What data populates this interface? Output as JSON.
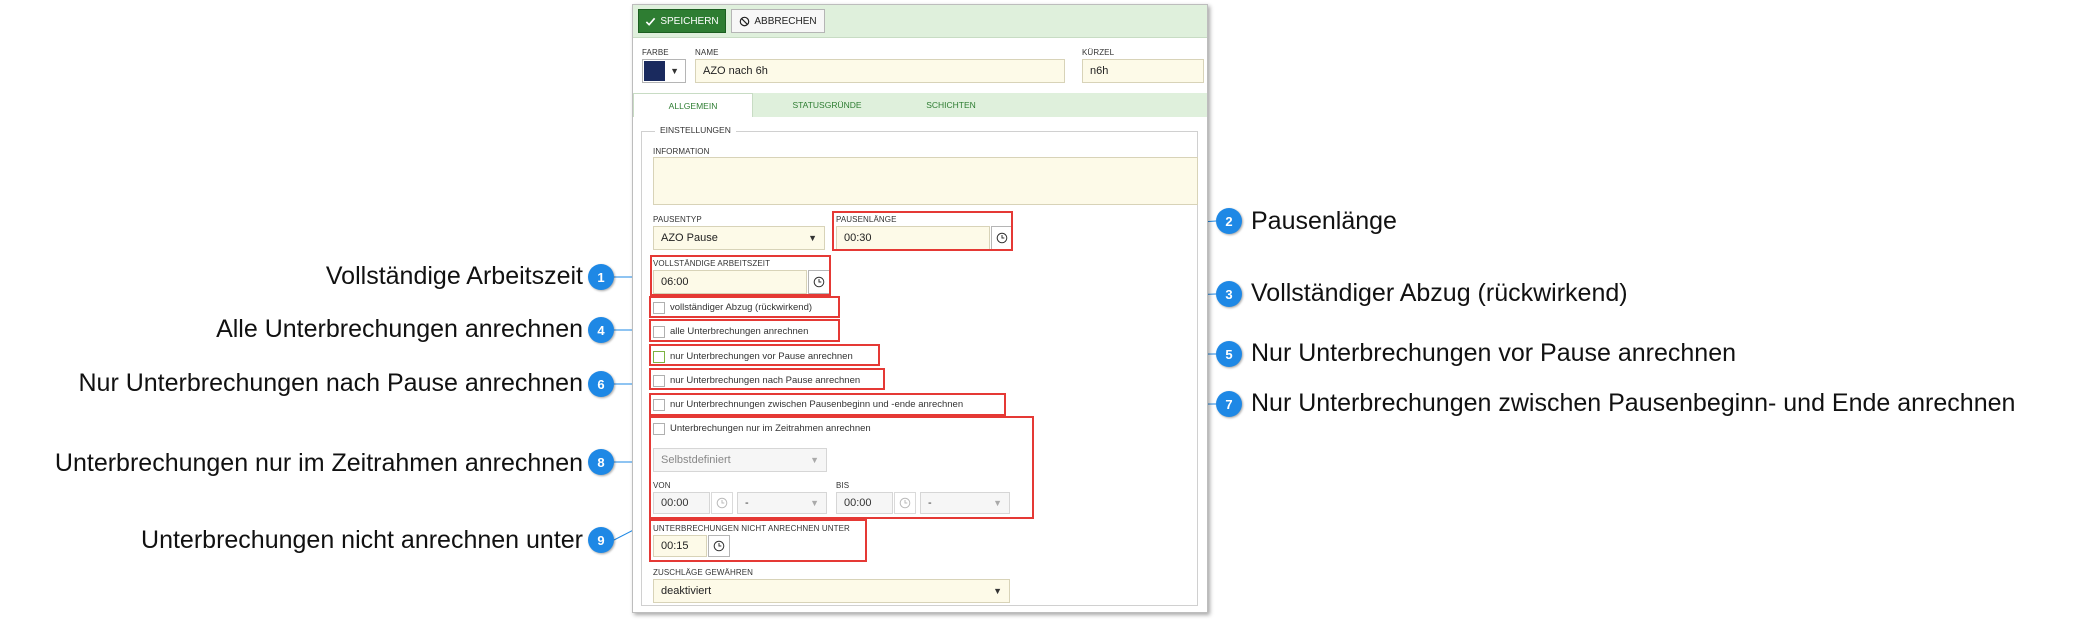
{
  "toolbar": {
    "save_label": "SPEICHERN",
    "cancel_label": "ABBRECHEN"
  },
  "header": {
    "farbe_label": "FARBE",
    "farbe_value": "#1a2a5e",
    "name_label": "NAME",
    "name_value": "AZO nach 6h",
    "kuerzel_label": "KÜRZEL",
    "kuerzel_value": "n6h"
  },
  "tabs": [
    {
      "label": "ALLGEMEIN"
    },
    {
      "label": "STATUSGRÜNDE"
    },
    {
      "label": "SCHICHTEN"
    }
  ],
  "settings": {
    "legend": "EINSTELLUNGEN",
    "information_label": "INFORMATION",
    "information_value": "",
    "pausentyp_label": "PAUSENTYP",
    "pausentyp_value": "AZO Pause",
    "pausenlaenge_label": "PAUSENLÄNGE",
    "pausenlaenge_value": "00:30",
    "arbeitszeit_label": "VOLLSTÄNDIGE ARBEITSZEIT",
    "arbeitszeit_value": "06:00",
    "cb_abzug": "vollständiger Abzug (rückwirkend)",
    "cb_alle": "alle Unterbrechungen anrechnen",
    "cb_vor": "nur Unterbrechungen vor Pause anrechnen",
    "cb_nach": "nur Unterbrechungen nach Pause anrechnen",
    "cb_zwischen": "nur Unterbrechnungen zwischen Pausenbeginn und -ende anrechnen",
    "cb_zeitrahmen": "Unterbrechungen nur im Zeitrahmen anrechnen",
    "zeitrahmen_select": "Selbstdefiniert",
    "von_label": "VON",
    "von_value": "00:00",
    "von_select": "-",
    "bis_label": "BIS",
    "bis_value": "00:00",
    "bis_select": "-",
    "nicht_anrechnen_label": "UNTERBRECHUNGEN NICHT ANRECHNEN UNTER",
    "nicht_anrechnen_value": "00:15",
    "zuschlaege_label": "ZUSCHLÄGE GEWÄHREN",
    "zuschlaege_value": "deaktiviert"
  },
  "callouts": [
    {
      "number": "1",
      "text": "Vollständige Arbeitszeit"
    },
    {
      "number": "2",
      "text": "Pausenlänge"
    },
    {
      "number": "3",
      "text": "Vollständiger Abzug (rückwirkend)"
    },
    {
      "number": "4",
      "text": "Alle Unterbrechungen anrechnen"
    },
    {
      "number": "5",
      "text": "Nur Unterbrechungen vor Pause anrechnen"
    },
    {
      "number": "6",
      "text": "Nur Unterbrechungen nach Pause anrechnen"
    },
    {
      "number": "7",
      "text": "Nur Unterbrechungen zwischen Pausenbeginn- und Ende anrechnen"
    },
    {
      "number": "8",
      "text": "Unterbrechungen nur im Zeitrahmen anrechnen"
    },
    {
      "number": "9",
      "text": "Unterbrechungen nicht anrechnen unter"
    }
  ],
  "colors": {
    "accent_green": "#2e7d32",
    "highlight_red": "#e53935",
    "callout_blue": "#1e88e5"
  }
}
